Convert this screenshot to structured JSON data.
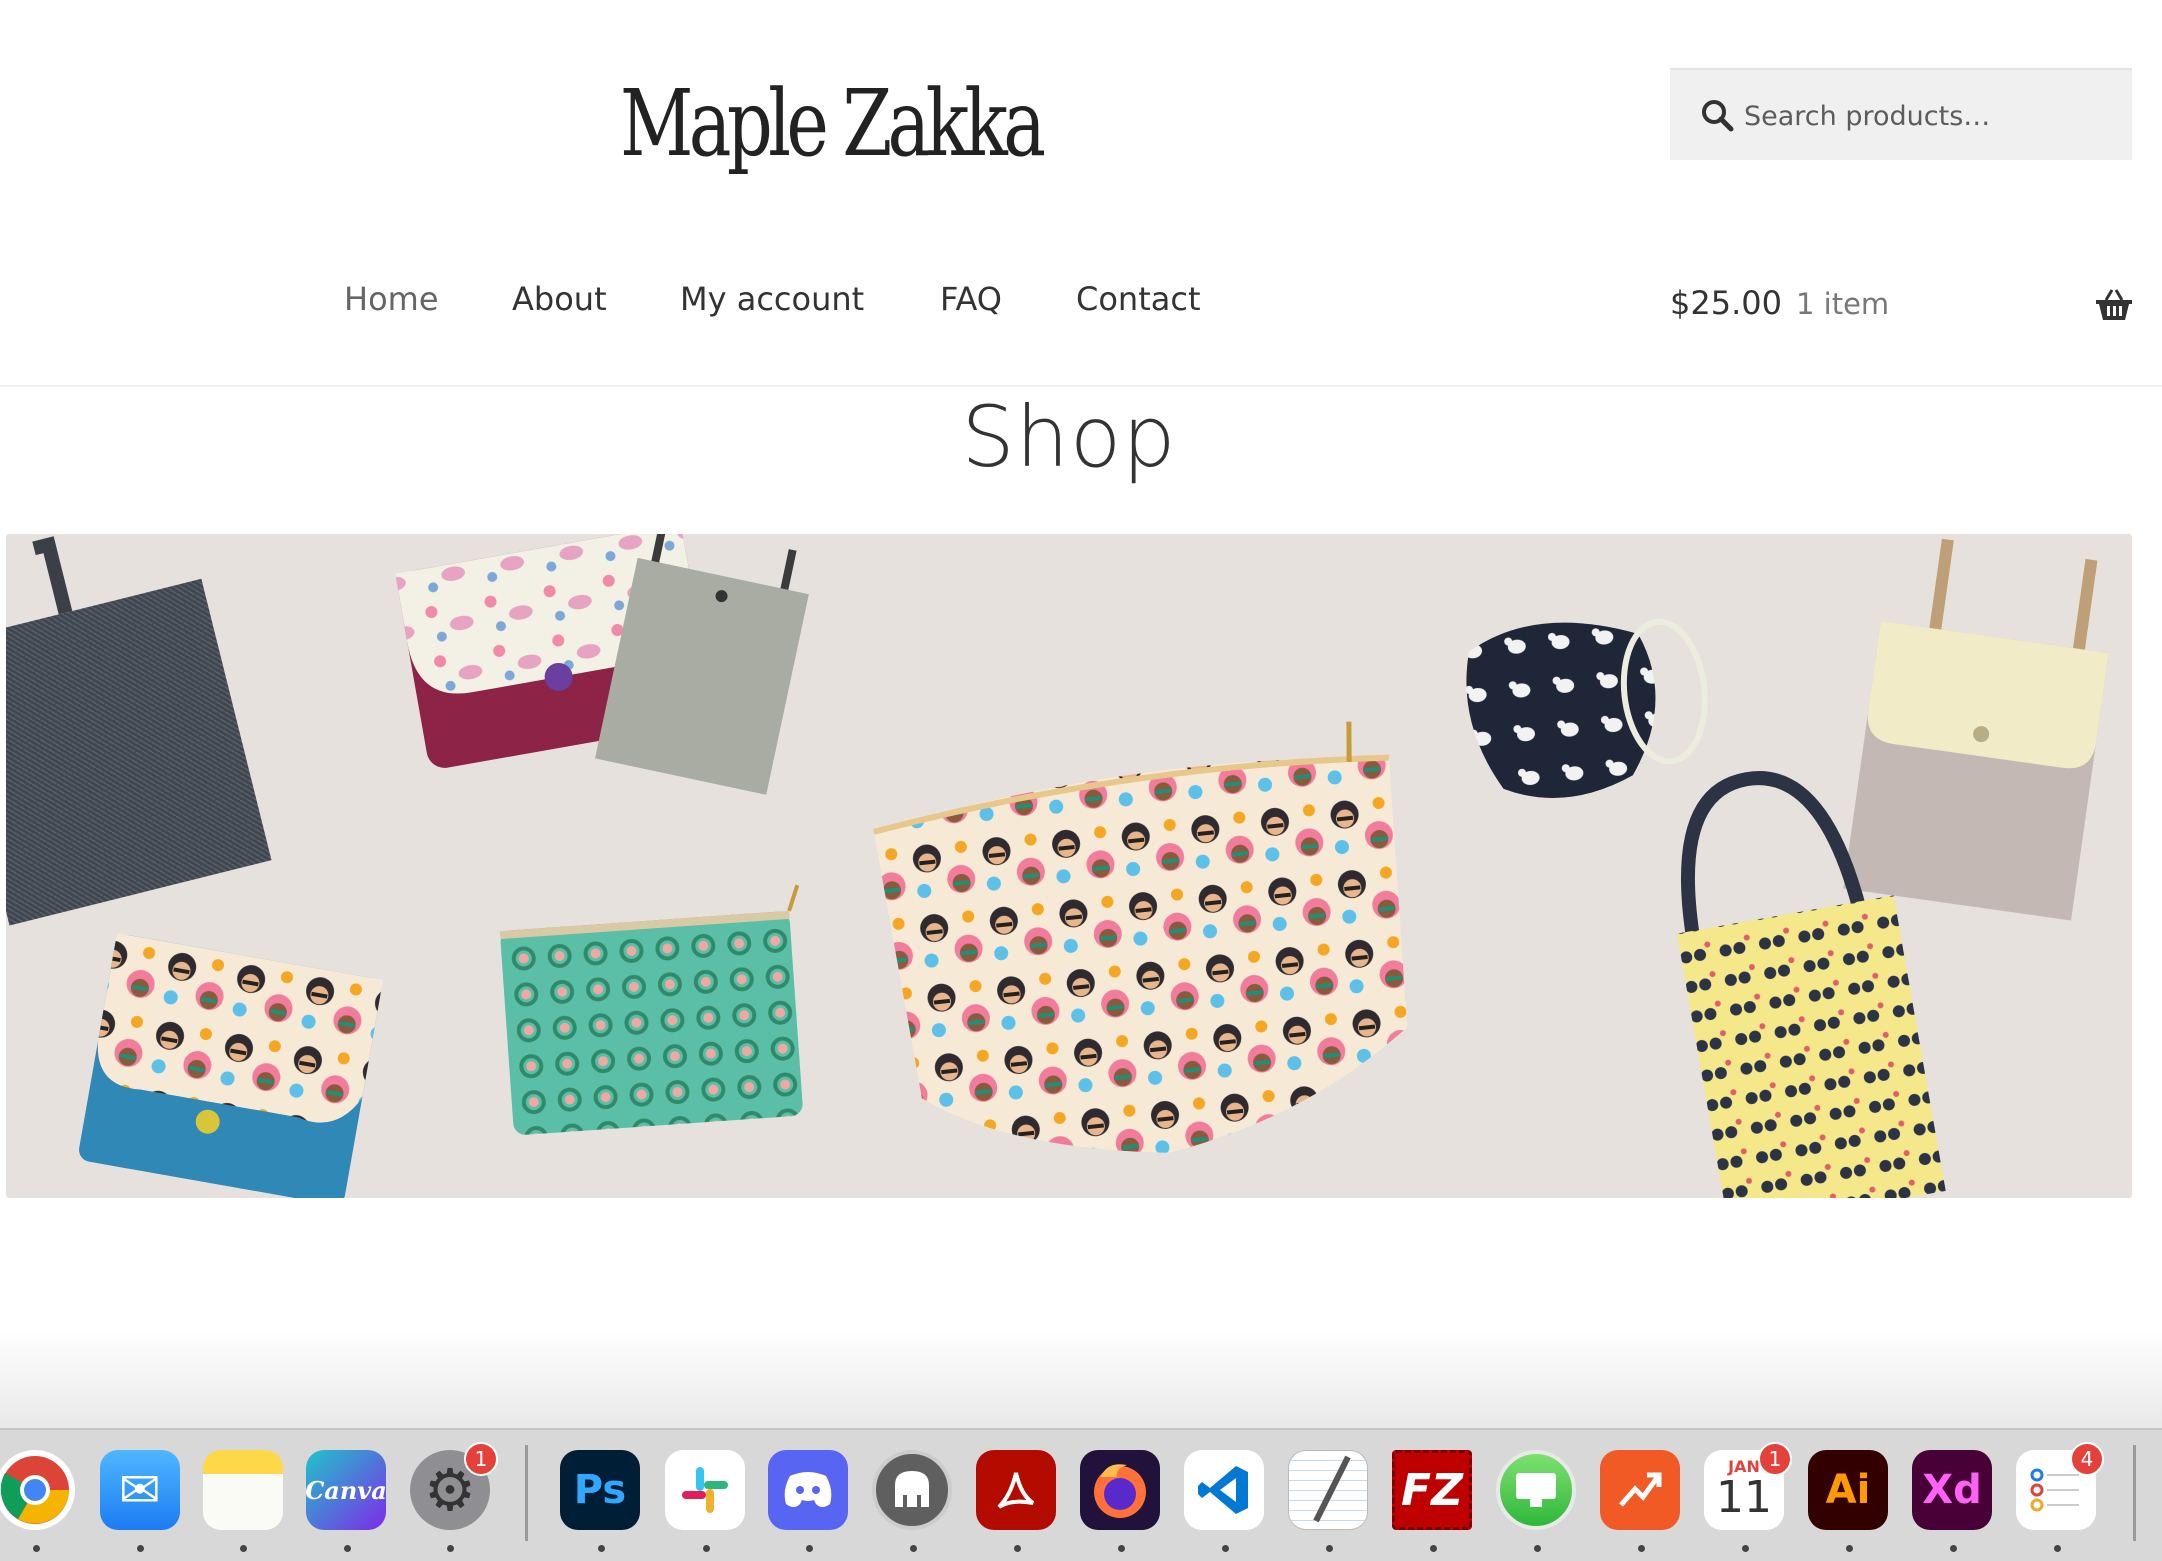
{
  "site": {
    "logo": "Maple Zakka",
    "search_placeholder": "Search products…"
  },
  "nav": {
    "items": [
      {
        "label": "Home"
      },
      {
        "label": "About"
      },
      {
        "label": "My account"
      },
      {
        "label": "FAQ"
      },
      {
        "label": "Contact"
      }
    ]
  },
  "cart": {
    "amount": "$25.00",
    "count": "1 item"
  },
  "page": {
    "title": "Shop"
  },
  "dock": {
    "apps": [
      {
        "name": "Chrome",
        "label": ""
      },
      {
        "name": "Mail",
        "label": "✉"
      },
      {
        "name": "Notes",
        "label": ""
      },
      {
        "name": "Canva",
        "label": "Canva"
      },
      {
        "name": "System Settings",
        "label": "⚙",
        "badge": "1"
      },
      {
        "name": "Photoshop",
        "label": "Ps"
      },
      {
        "name": "Slack",
        "label": "#"
      },
      {
        "name": "Discord",
        "label": ""
      },
      {
        "name": "MAMP",
        "label": ""
      },
      {
        "name": "Acrobat",
        "label": ""
      },
      {
        "name": "Firefox",
        "label": ""
      },
      {
        "name": "VS Code",
        "label": ""
      },
      {
        "name": "TextEdit",
        "label": ""
      },
      {
        "name": "FileZilla",
        "label": "FZ"
      },
      {
        "name": "Screen Sharing",
        "label": ""
      },
      {
        "name": "Instastats",
        "label": ""
      },
      {
        "name": "Calendar",
        "label": "11",
        "month": "JAN",
        "badge": "1"
      },
      {
        "name": "Illustrator",
        "label": "Ai"
      },
      {
        "name": "Adobe XD",
        "label": "Xd"
      },
      {
        "name": "Reminders",
        "label": "",
        "badge": "4"
      }
    ]
  }
}
